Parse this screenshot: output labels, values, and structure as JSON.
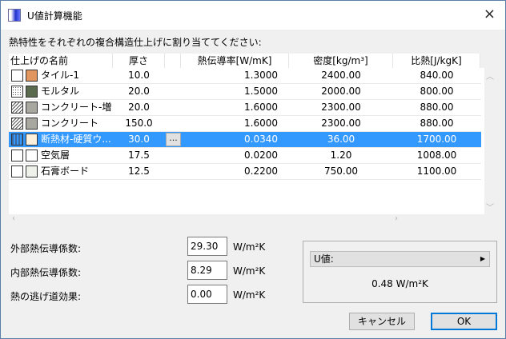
{
  "window": {
    "title": "U値計算機能",
    "close_icon": "×"
  },
  "prompt": "熱特性をそれぞれの複合構造仕上げに割り当ててください:",
  "table": {
    "headers": [
      "仕上げの名前",
      "厚さ",
      "",
      "熱伝導率[W/mK]",
      "密度[kg/m³]",
      "比熱[J/kgK]"
    ],
    "rows": [
      {
        "name": "タイル-1",
        "thickness": "10.0",
        "conductivity": "1.3000",
        "density": "2400.00",
        "specific_heat": "840.00",
        "pattern": "empty",
        "color": "#e0965e"
      },
      {
        "name": "モルタル",
        "thickness": "20.0",
        "conductivity": "1.5000",
        "density": "2000.00",
        "specific_heat": "800.00",
        "pattern": "dots",
        "color": "#5a6a4e"
      },
      {
        "name": "コンクリート-増し...",
        "thickness": "20.0",
        "conductivity": "1.6000",
        "density": "2300.00",
        "specific_heat": "880.00",
        "pattern": "hatch",
        "color": "#a8a8a0"
      },
      {
        "name": "コンクリート",
        "thickness": "150.0",
        "conductivity": "1.6000",
        "density": "2300.00",
        "specific_heat": "880.00",
        "pattern": "hatch",
        "color": "#a8a8a0"
      },
      {
        "name": "断熱材-硬質ウ...",
        "thickness": "30.0",
        "conductivity": "0.0340",
        "density": "36.00",
        "specific_heat": "1700.00",
        "pattern": "insulation",
        "color": "#fdf0dc",
        "selected": true,
        "more_label": "..."
      },
      {
        "name": "空気層",
        "thickness": "17.5",
        "conductivity": "0.0200",
        "density": "1.20",
        "specific_heat": "1008.00",
        "pattern": "empty",
        "color": "#ffffff"
      },
      {
        "name": "石膏ボード",
        "thickness": "12.5",
        "conductivity": "0.2200",
        "density": "750.00",
        "specific_heat": "1100.00",
        "pattern": "empty",
        "color": "#eef2ea"
      }
    ]
  },
  "fields": [
    {
      "label": "外部熱伝導係数:",
      "value": "29.30",
      "unit": "W/m²K"
    },
    {
      "label": "内部熱伝導係数:",
      "value": "8.29",
      "unit": "W/m²K"
    },
    {
      "label": "熱の逃げ道効果:",
      "value": "0.00",
      "unit": "W/m²K"
    }
  ],
  "u_value": {
    "label": "U値:",
    "value": "0.48  W/m²K"
  },
  "buttons": {
    "cancel": "キャンセル",
    "ok": "OK"
  },
  "colors": {
    "selection": "#3399ff",
    "ok_border": "#0078d7"
  }
}
